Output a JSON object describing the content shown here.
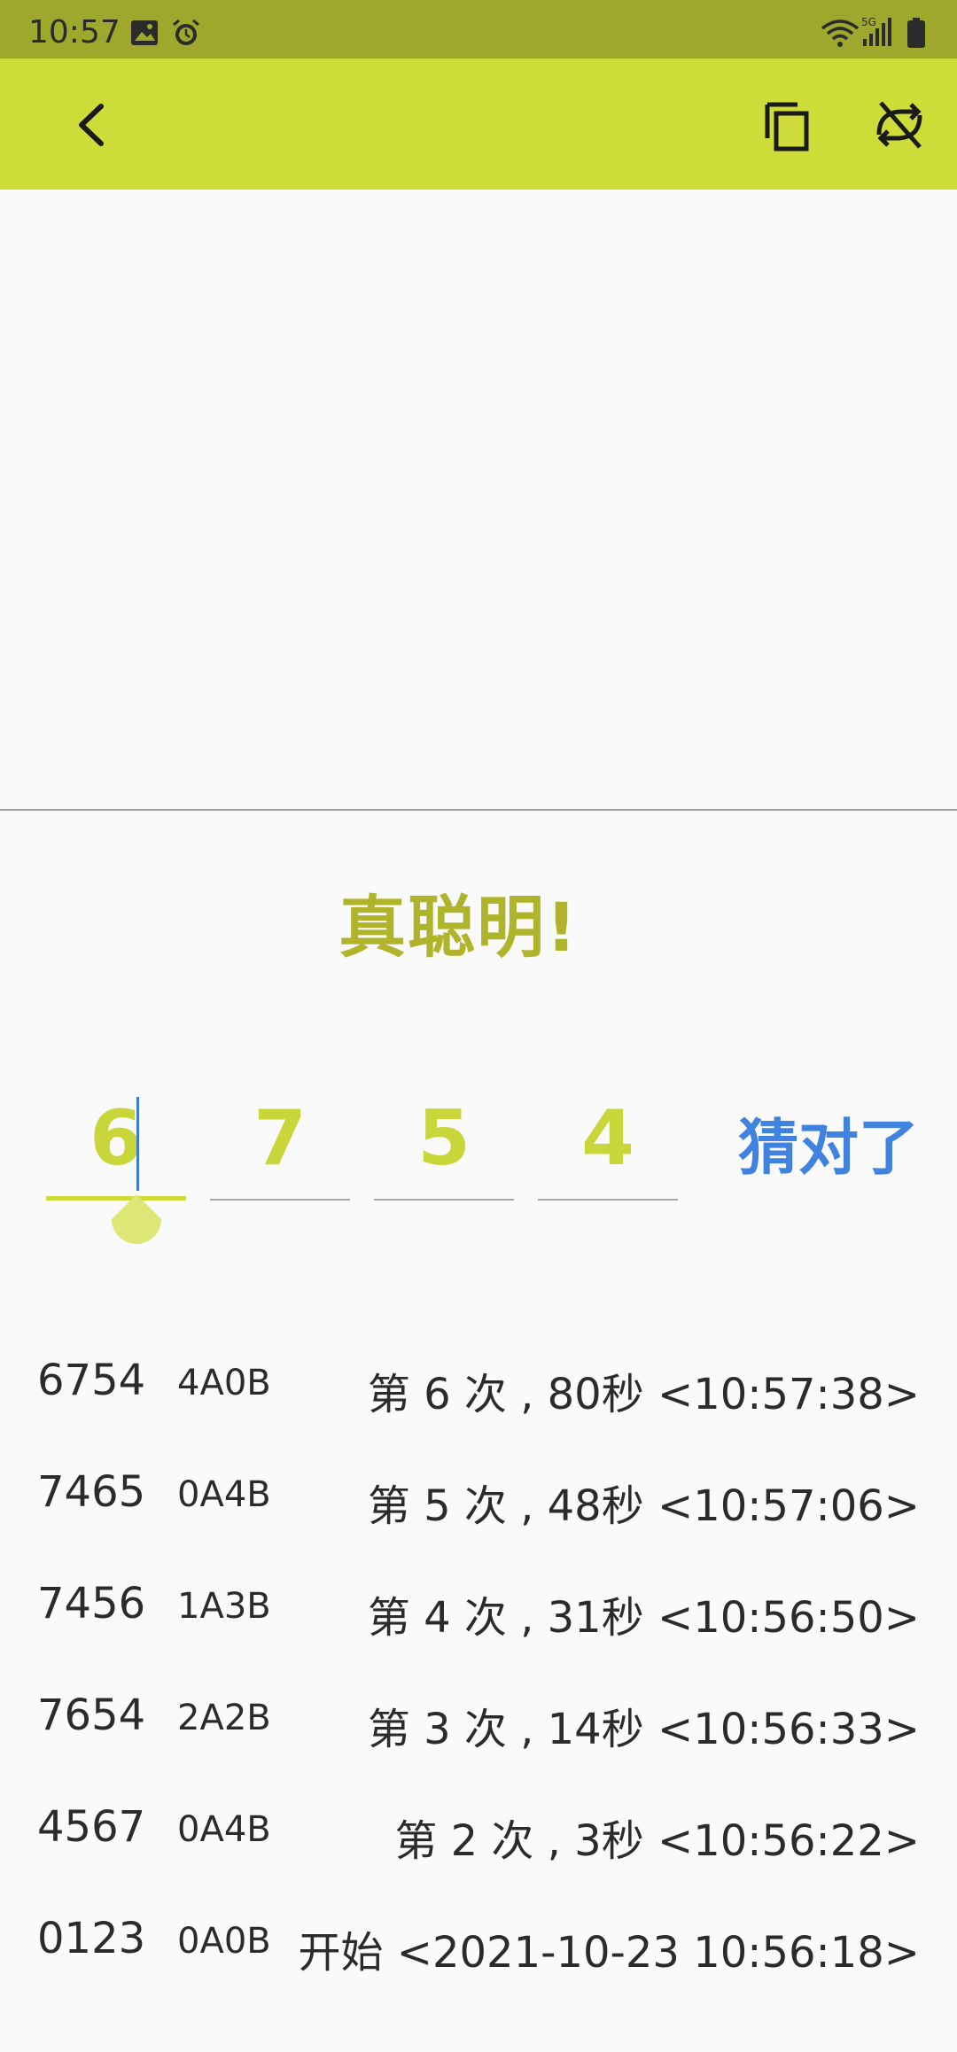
{
  "status_bar": {
    "time": "10:57",
    "left_icons": [
      "gallery-icon",
      "alarm-icon"
    ],
    "right_icons": [
      "wifi-icon",
      "5g-signal-icon",
      "battery-icon"
    ],
    "network": "5G"
  },
  "app_bar": {
    "back_icon": "back-arrow-icon",
    "actions": [
      "copy-icon",
      "shuffle-off-icon"
    ],
    "background": "#cddc39"
  },
  "result_message": "真聪明!",
  "guess_input": {
    "digits": [
      "6",
      "7",
      "5",
      "4"
    ],
    "active_index": 0
  },
  "submit_label": "猜对了",
  "history": [
    {
      "guess": "6754",
      "result": "4A0B",
      "info": "第 6 次 , 80秒 <10:57:38>"
    },
    {
      "guess": "7465",
      "result": "0A4B",
      "info": "第 5 次 , 48秒 <10:57:06>"
    },
    {
      "guess": "7456",
      "result": "1A3B",
      "info": "第 4 次 , 31秒 <10:56:50>"
    },
    {
      "guess": "7654",
      "result": "2A2B",
      "info": "第 3 次 , 14秒 <10:56:33>"
    },
    {
      "guess": "4567",
      "result": "0A4B",
      "info": "第 2 次 , 3秒 <10:56:22>"
    },
    {
      "guess": "0123",
      "result": "0A0B",
      "info": "开始 <2021-10-23 10:56:18>"
    }
  ],
  "colors": {
    "accent": "#cddc39",
    "status_bar": "#9da82c",
    "message": "#afb42b",
    "digit": "#c8d63a",
    "submit": "#3f82e0",
    "cursor": "#3b7be0"
  }
}
